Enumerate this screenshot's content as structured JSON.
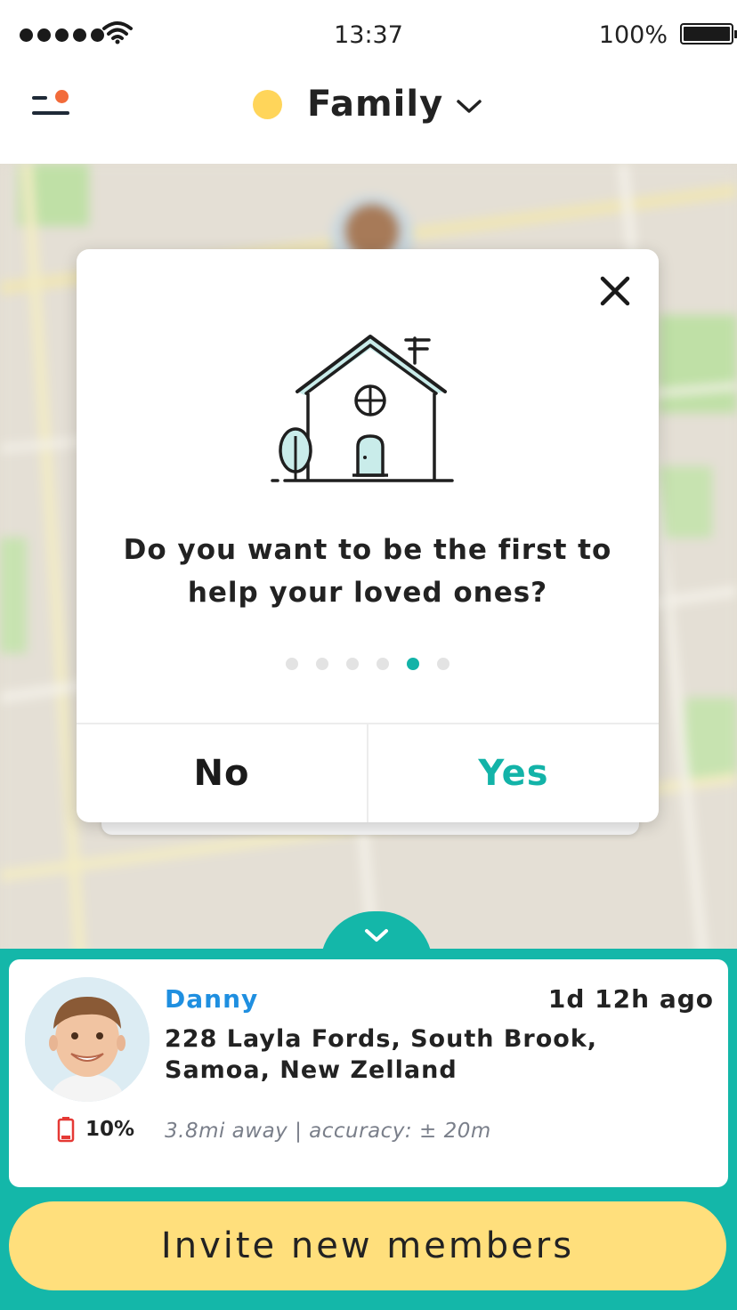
{
  "status_bar": {
    "time": "13:37",
    "battery_percent": "100%",
    "signal_bars": 5
  },
  "header": {
    "group_name": "Family",
    "group_color": "#ffd55a",
    "menu_icon": "menu-icon",
    "notification_dot_color": "#f26b3a"
  },
  "dialog": {
    "question": "Do you want to be the first to help your loved ones?",
    "illustration": "house-icon",
    "pager": {
      "total": 6,
      "active": 5
    },
    "no_label": "No",
    "yes_label": "Yes",
    "accent_color": "#13b3a8"
  },
  "member": {
    "name": "Danny",
    "last_seen": "1d 12h ago",
    "address": "228 Layla Fords, South Brook, Samoa, New Zelland",
    "battery": "10%",
    "distance_accuracy": "3.8mi away  |  accuracy: ± 20m"
  },
  "actions": {
    "invite_label": "Invite new members"
  },
  "colors": {
    "teal": "#14b7a9",
    "invite_button": "#ffdf7c",
    "member_name": "#1f8fe0"
  }
}
